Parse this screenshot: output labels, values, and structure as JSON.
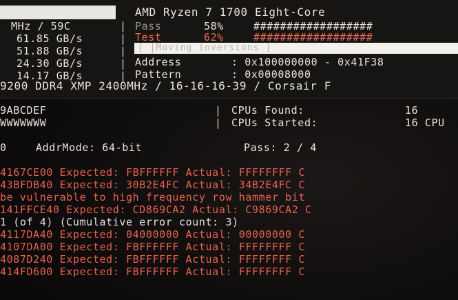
{
  "header": {
    "cpu_name": "AMD Ryzen 7 1700 Eight-Core",
    "left_col": [
      "MHz / 59C",
      "61.85 GB/s",
      "51.88 GB/s",
      "24.30 GB/s",
      "14.17 GB/s"
    ],
    "pass_label": "Pass",
    "pass_pct": "58%",
    "pass_bar": "##################",
    "test_label": "Test",
    "test_pct": "62%",
    "test_bar": "##################",
    "strip_text": "[ |Moving inversions ]",
    "address_label": "Address",
    "address_value": ": 0x100000000 - 0x41F38",
    "pattern_label": "Pattern",
    "pattern_value": ": 0x00008000",
    "memory_line": "9200 DDR4 XMP 2400MHz / 16-16-16-39 / Corsair F"
  },
  "cpu_info": {
    "hex_line1": "9ABCDEF",
    "hex_line2": "WWWWWWW",
    "cpus_found_label": "CPUs Found:",
    "cpus_found_value": "16",
    "cpus_started_label": "CPUs Started:",
    "cpus_started_value": "16 CPU"
  },
  "status": {
    "left": "0",
    "addr_mode": "AddrMode: 64-bit",
    "pass": "Pass: 2 / 4"
  },
  "errors": [
    "4167CE00 Expected: FBFFFFFF Actual: FFFFFFFF C",
    "43BFDB40 Expected: 30B2E4FC Actual: 34B2E4FC C",
    "be vulnerable to high frequency row hammer bit",
    "141FFCE40 Expected: CD869CA2 Actual: C9869CA2 C",
    "1 (of 4) (Cumulative error count: 3)",
    "4117DA40 Expected: 04000000 Actual: 00000000 C",
    "4107DA00 Expected: FBFFFFFF Actual: FFFFFFFF C",
    "4087D240 Expected: FBFFFFFF Actual: FFFFFFFF C",
    "414FD600 Expected: FBFFFFFF Actual: FFFFFFFF C"
  ],
  "colors": {
    "error_text": "#e9624f",
    "normal_text": "#e8e4de",
    "background": "#0c0b0b"
  }
}
